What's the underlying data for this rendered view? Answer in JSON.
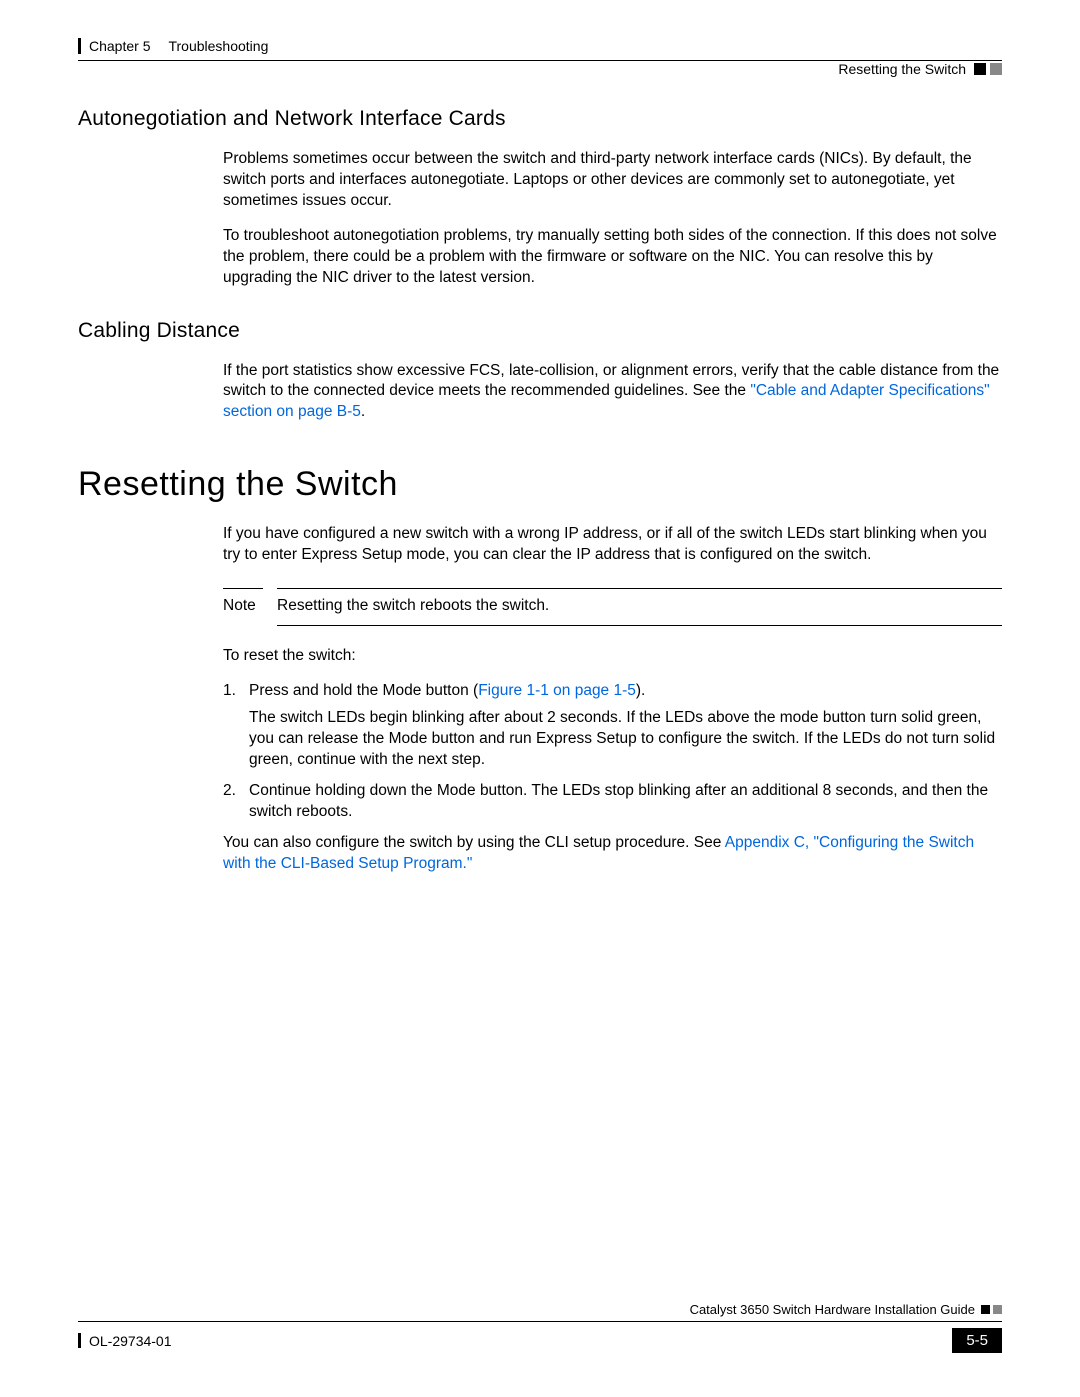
{
  "header": {
    "chapter_label": "Chapter 5",
    "chapter_title": "Troubleshooting",
    "section_label": "Resetting the Switch"
  },
  "sections": {
    "autoneg": {
      "title": "Autonegotiation and Network Interface Cards",
      "p1": "Problems sometimes occur between the switch and third-party network interface cards (NICs). By default, the switch ports and interfaces autonegotiate. Laptops or other devices are commonly set to autonegotiate, yet sometimes issues occur.",
      "p2": "To troubleshoot autonegotiation problems, try manually setting both sides of the connection. If this does not solve the problem, there could be a problem with the firmware or software on the NIC. You can resolve this by upgrading the NIC driver to the latest version."
    },
    "cabling": {
      "title": "Cabling Distance",
      "p1_pre": "If the port statistics show excessive FCS, late-collision, or alignment errors, verify that the cable distance from the switch to the connected device meets the recommended guidelines. See the ",
      "p1_link": "\"Cable and Adapter Specifications\" section on page B-5",
      "p1_post": "."
    },
    "reset": {
      "title": "Resetting the Switch",
      "p1": "If you have configured a new switch with a wrong IP address, or if all of the switch LEDs start blinking when you try to enter Express Setup mode, you can clear the IP address that is configured on the switch.",
      "note_label": "Note",
      "note_text": "Resetting the switch reboots the switch.",
      "p2": "To reset the switch:",
      "step1_num": "1.",
      "step1_pre": "Press and hold the Mode button (",
      "step1_link": "Figure 1-1 on page 1-5",
      "step1_post": ").",
      "step1_body": "The switch LEDs begin blinking after about 2 seconds. If the LEDs above the mode button turn solid green, you can release the Mode button and run Express Setup to configure the switch. If the LEDs do not turn solid green, continue with the next step.",
      "step2_num": "2.",
      "step2_body": "Continue holding down the Mode button. The LEDs stop blinking after an additional 8 seconds, and then the switch reboots.",
      "p3_pre": "You can also configure the switch by using the CLI setup procedure. See ",
      "p3_link": "Appendix C, \"Configuring the Switch with the CLI-Based Setup Program.\""
    }
  },
  "footer": {
    "guide_title": "Catalyst 3650 Switch Hardware Installation Guide",
    "doc_id": "OL-29734-01",
    "page_number": "5-5"
  }
}
